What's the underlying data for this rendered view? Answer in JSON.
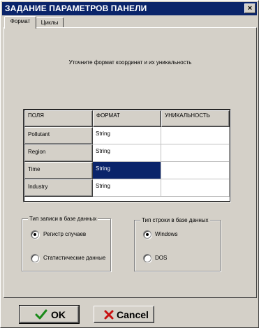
{
  "window": {
    "title": "ЗАДАНИЕ ПАРАМЕТРОВ ПАНЕЛИ",
    "close_glyph": "×"
  },
  "tabs": [
    {
      "label": "Формат"
    },
    {
      "label": "Циклы"
    }
  ],
  "caption": "Уточните формат координат и их уникальность",
  "grid": {
    "headers": [
      "ПОЛЯ",
      "ФОРМАТ",
      "УНИКАЛЬНОСТЬ"
    ],
    "rows": [
      {
        "field": "Pollutant",
        "format": "String",
        "unique": ""
      },
      {
        "field": "Region",
        "format": "String",
        "unique": ""
      },
      {
        "field": "Time",
        "format": "String",
        "unique": ""
      },
      {
        "field": "Industry",
        "format": "String",
        "unique": ""
      }
    ],
    "selected_row": 2
  },
  "record_type": {
    "label": "Тип записи в базе данных",
    "options": [
      {
        "label": "Регистр случаев",
        "checked": true
      },
      {
        "label": "Статистические данные",
        "checked": false
      }
    ]
  },
  "line_type": {
    "label": "Тип строки в базе данных",
    "options": [
      {
        "label": "Windows",
        "checked": true
      },
      {
        "label": "DOS",
        "checked": false
      }
    ]
  },
  "buttons": {
    "ok": {
      "label": "OK",
      "icon": "checkmark-icon",
      "color": "#1a8a1a"
    },
    "cancel": {
      "label": "Cancel",
      "icon": "x-icon",
      "color": "#c81010"
    }
  },
  "colors": {
    "titlebar": "#0a246a",
    "selection": "#0a246a",
    "face": "#d4d0c8"
  }
}
